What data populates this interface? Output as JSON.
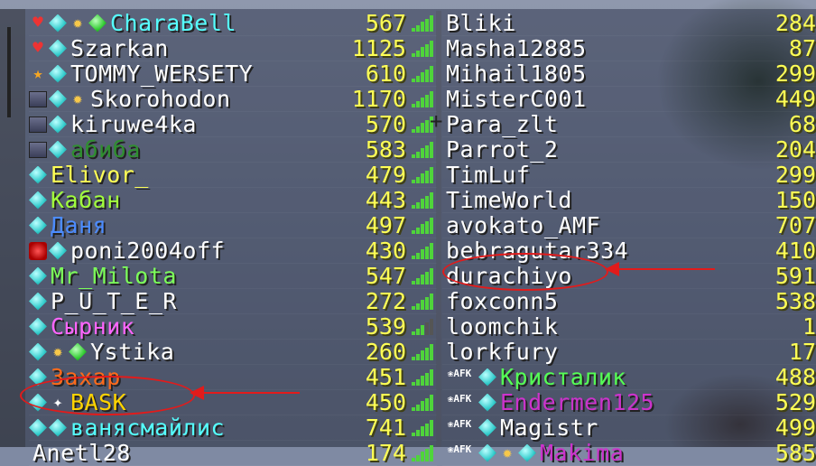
{
  "tablist": {
    "left": [
      {
        "badges": [
          "heart",
          "diamond",
          "gold",
          "emerald"
        ],
        "name": "CharaBell",
        "color": "#55ffff",
        "ping": "567",
        "signal": 5
      },
      {
        "badges": [
          "heart",
          "diamond"
        ],
        "name": "Szarkan",
        "color": "#ffffff",
        "ping": "1125",
        "signal": 5
      },
      {
        "badges": [
          "star",
          "diamond"
        ],
        "name": "TOMMY_WERSETY",
        "color": "#ffffff",
        "ping": "610",
        "signal": 5
      },
      {
        "badges": [
          "chest",
          "diamond",
          "gold"
        ],
        "name": "Skorohodon",
        "color": "#ffffff",
        "ping": "1170",
        "signal": 5
      },
      {
        "badges": [
          "chest",
          "diamond"
        ],
        "name": "kiruwe4ka",
        "color": "#ffffff",
        "ping": "570",
        "signal": 5
      },
      {
        "badges": [
          "chest",
          "diamond"
        ],
        "name": "абиба",
        "color": "#2f8f2f",
        "ping": "583",
        "signal": 5
      },
      {
        "badges": [
          "diamond"
        ],
        "name": "Elivor_",
        "color": "#ffff55",
        "ping": "479",
        "signal": 5
      },
      {
        "badges": [
          "diamond"
        ],
        "name": "Кабан",
        "color": "#a2ff3c",
        "ping": "443",
        "signal": 5
      },
      {
        "badges": [
          "diamond"
        ],
        "name": "Даня",
        "color": "#4c8cff",
        "ping": "497",
        "signal": 5
      },
      {
        "badges": [
          "ruby",
          "diamond"
        ],
        "name": "poni2004off",
        "color": "#ffffff",
        "ping": "430",
        "signal": 5
      },
      {
        "badges": [
          "diamond"
        ],
        "name": "Mr_Milota",
        "color": "#7cff5a",
        "ping": "547",
        "signal": 5
      },
      {
        "badges": [
          "diamond"
        ],
        "name": "P_U_T_E_R",
        "color": "#ffffff",
        "ping": "272",
        "signal": 5
      },
      {
        "badges": [
          "diamond"
        ],
        "name": "Сырник",
        "color": "#ff66ff",
        "ping": "539",
        "signal": 3
      },
      {
        "badges": [
          "diamond",
          "gold",
          "emerald"
        ],
        "name": "Ystika",
        "color": "#ffffff",
        "ping": "260",
        "signal": 5
      },
      {
        "badges": [
          "diamond"
        ],
        "name": "Захар",
        "color": "#ff6a1a",
        "ping": "451",
        "signal": 5
      },
      {
        "badges": [
          "diamond",
          "white"
        ],
        "name": "BASK",
        "color": "#ffd400",
        "ping": "450",
        "signal": 5
      },
      {
        "badges": [
          "diamond",
          "diamond"
        ],
        "name": "ванясмайлис",
        "color": "#55ffff",
        "ping": "741",
        "signal": 5
      },
      {
        "badges": [],
        "name": "Anetl28",
        "color": "#ffffff",
        "ping": "174",
        "signal": 5
      }
    ],
    "right": [
      {
        "badges": [],
        "name": "Bliki",
        "color": "#ffffff",
        "ping": "284"
      },
      {
        "badges": [],
        "name": "Masha12885",
        "color": "#ffffff",
        "ping": "87"
      },
      {
        "badges": [],
        "name": "Mihail1805",
        "color": "#ffffff",
        "ping": "299"
      },
      {
        "badges": [],
        "name": "MisterC001",
        "color": "#ffffff",
        "ping": "449"
      },
      {
        "badges": [],
        "name": "Para_zlt",
        "color": "#ffffff",
        "ping": "68"
      },
      {
        "badges": [],
        "name": "Parrot_2",
        "color": "#ffffff",
        "ping": "204"
      },
      {
        "badges": [],
        "name": "TimLuf",
        "color": "#ffffff",
        "ping": "299"
      },
      {
        "badges": [],
        "name": "TimeWorld",
        "color": "#ffffff",
        "ping": "150"
      },
      {
        "badges": [],
        "name": "avokato_AMF",
        "color": "#ffffff",
        "ping": "707"
      },
      {
        "badges": [],
        "name": "bebragutar334",
        "color": "#ffffff",
        "ping": "410"
      },
      {
        "badges": [],
        "name": "durachiyo",
        "color": "#ffffff",
        "ping": "591"
      },
      {
        "badges": [],
        "name": "foxconn5",
        "color": "#ffffff",
        "ping": "538"
      },
      {
        "badges": [],
        "name": "loomchik",
        "color": "#ffffff",
        "ping": "1"
      },
      {
        "badges": [],
        "name": "lorkfury",
        "color": "#ffffff",
        "ping": "17"
      },
      {
        "badges": [
          "afk",
          "diamond"
        ],
        "name": "Кристалик",
        "color": "#55ff55",
        "ping": "488"
      },
      {
        "badges": [
          "afk",
          "diamond"
        ],
        "name": "Endermen125",
        "color": "#cc33cc",
        "ping": "529"
      },
      {
        "badges": [
          "afk",
          "diamond"
        ],
        "name": "Magistr",
        "color": "#ffffff",
        "ping": "499"
      },
      {
        "badges": [
          "afk",
          "diamond",
          "gold",
          "diamond"
        ],
        "name": "Makima",
        "color": "#cc33cc",
        "ping": "585"
      }
    ]
  },
  "afk_label": "AFK",
  "icons": {
    "heart": "♥",
    "star": "★",
    "gold": "✹",
    "white": "✦"
  },
  "annotations": {
    "highlighted_players": [
      "BASK",
      "durachiyo"
    ],
    "highlight_color": "#e21b1b"
  }
}
